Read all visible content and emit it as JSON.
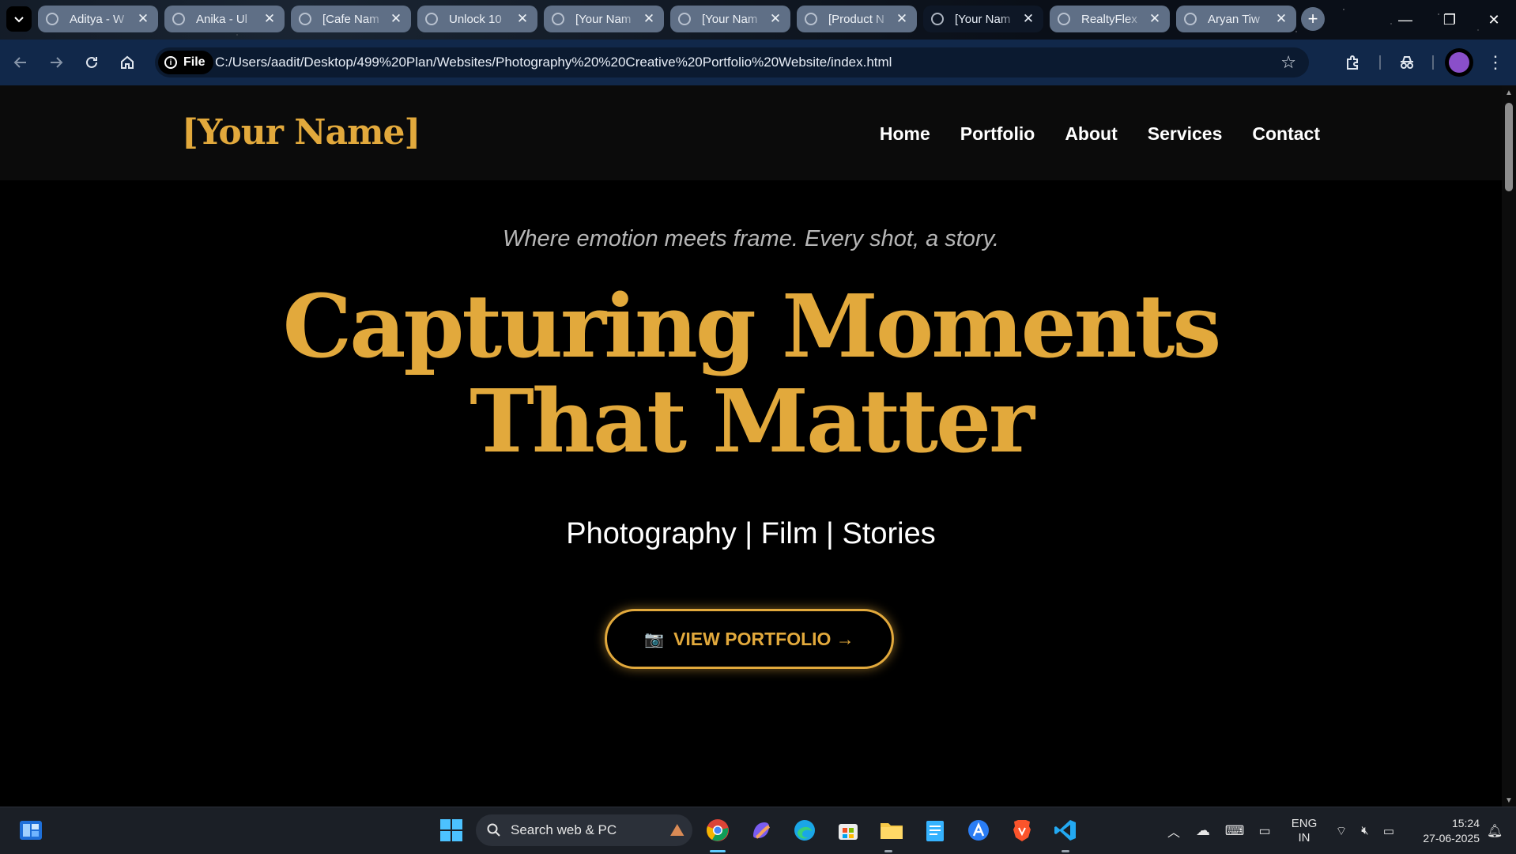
{
  "browser": {
    "tabs": [
      {
        "label": "Aditya - W",
        "active": false
      },
      {
        "label": "Anika - Ul",
        "active": false
      },
      {
        "label": "[Cafe Nam",
        "active": false
      },
      {
        "label": "Unlock 10",
        "active": false
      },
      {
        "label": "[Your Nam",
        "active": false
      },
      {
        "label": "[Your Nam",
        "active": false
      },
      {
        "label": "[Product N",
        "active": false
      },
      {
        "label": "[Your Nam",
        "active": true
      },
      {
        "label": "RealtyFlex",
        "active": false
      },
      {
        "label": "Aryan Tiw",
        "active": false
      }
    ],
    "chip_label": "File",
    "url": "C:/Users/aadit/Desktop/499%20Plan/Websites/Photography%20%20Creative%20Portfolio%20Website/index.html"
  },
  "site": {
    "logo": "[Your Name]",
    "nav": [
      "Home",
      "Portfolio",
      "About",
      "Services",
      "Contact"
    ],
    "tagline": "Where emotion meets frame. Every shot, a story.",
    "hero_line1": "Capturing Moments",
    "hero_line2": "That Matter",
    "subtitle": "Photography | Film | Stories",
    "cta_icon": "📷",
    "cta_label": "VIEW PORTFOLIO →",
    "accent_color": "#e2a93c"
  },
  "taskbar": {
    "search_placeholder": "Search web & PC",
    "language_line1": "ENG",
    "language_line2": "IN",
    "time": "15:24",
    "date": "27-06-2025"
  }
}
